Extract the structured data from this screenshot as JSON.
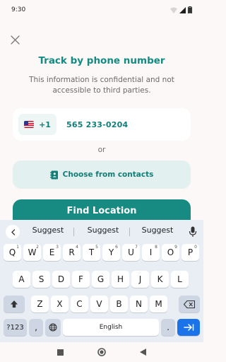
{
  "status_bar": {
    "time": "9:30"
  },
  "header": {
    "close_icon": "close-icon"
  },
  "main": {
    "title": "Track by phone number",
    "subtitle": "This information is confidential and not accessible to third parties.",
    "country_code": "+1",
    "phone_number": "565 233-0204",
    "or_label": "or",
    "contacts_button": "Choose from contacts",
    "find_button": "Find Location"
  },
  "keyboard": {
    "suggestions": [
      "Suggest",
      "Suggest",
      "Suggest"
    ],
    "row1": [
      {
        "k": "Q",
        "h": "1"
      },
      {
        "k": "W",
        "h": "2"
      },
      {
        "k": "E",
        "h": "3"
      },
      {
        "k": "R",
        "h": "4"
      },
      {
        "k": "T",
        "h": "5"
      },
      {
        "k": "Y",
        "h": "6"
      },
      {
        "k": "U",
        "h": "7"
      },
      {
        "k": "I",
        "h": "8"
      },
      {
        "k": "O",
        "h": "9"
      },
      {
        "k": "P",
        "h": "0"
      }
    ],
    "row2": [
      "A",
      "S",
      "D",
      "F",
      "G",
      "H",
      "J",
      "K",
      "L"
    ],
    "row3": [
      "Z",
      "X",
      "C",
      "V",
      "B",
      "N",
      "M"
    ],
    "symbols_key": "?123",
    "comma_key": ",",
    "space_key": "English",
    "period_key": "."
  },
  "colors": {
    "accent": "#178a82",
    "accent_text": "#127e77",
    "accent_light": "#e2f1ef",
    "keyboard_bg": "#e9eef5",
    "enter_key": "#1a73e8"
  }
}
